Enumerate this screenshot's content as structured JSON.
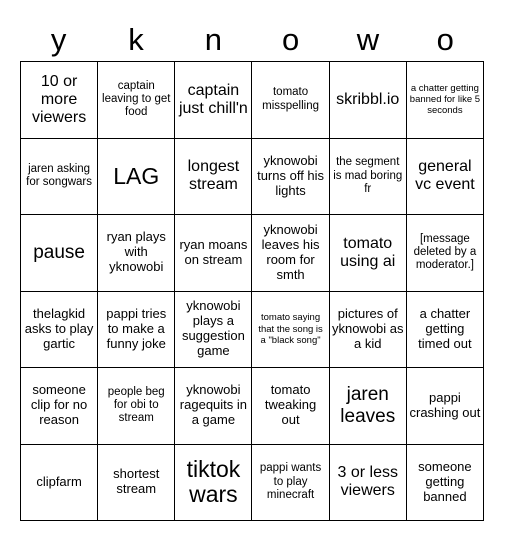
{
  "card": {
    "header_letters": [
      "y",
      "k",
      "n",
      "o",
      "w",
      "o"
    ],
    "rows": [
      [
        {
          "text": "10 or more viewers",
          "size": "lg"
        },
        {
          "text": "captain leaving to get food",
          "size": "sm"
        },
        {
          "text": "captain just chill'n",
          "size": "lg"
        },
        {
          "text": "tomato misspelling",
          "size": "sm"
        },
        {
          "text": "skribbl.io",
          "size": "lg"
        },
        {
          "text": "a chatter getting banned for like 5 seconds",
          "size": "xs"
        }
      ],
      [
        {
          "text": "jaren asking for songwars",
          "size": "sm"
        },
        {
          "text": "LAG",
          "size": "xxl"
        },
        {
          "text": "longest stream",
          "size": "lg"
        },
        {
          "text": "yknowobi turns off his lights",
          "size": "md"
        },
        {
          "text": "the segment is mad boring fr",
          "size": "sm"
        },
        {
          "text": "general vc event",
          "size": "lg"
        }
      ],
      [
        {
          "text": "pause",
          "size": "xl"
        },
        {
          "text": "ryan plays with yknowobi",
          "size": "md"
        },
        {
          "text": "ryan moans on stream",
          "size": "md"
        },
        {
          "text": "yknowobi leaves his room for smth",
          "size": "md"
        },
        {
          "text": "tomato using ai",
          "size": "lg"
        },
        {
          "text": "[message deleted by a moderator.]",
          "size": "sm"
        }
      ],
      [
        {
          "text": "thelagkid asks to play gartic",
          "size": "md"
        },
        {
          "text": "pappi tries to make a funny joke",
          "size": "md"
        },
        {
          "text": "yknowobi plays a suggestion game",
          "size": "md"
        },
        {
          "text": "tomato saying that the song is a \"black song\"",
          "size": "xs"
        },
        {
          "text": "pictures of yknowobi as a kid",
          "size": "md"
        },
        {
          "text": "a chatter getting timed out",
          "size": "md"
        }
      ],
      [
        {
          "text": "someone clip for no reason",
          "size": "md"
        },
        {
          "text": "people beg for obi to stream",
          "size": "sm"
        },
        {
          "text": "yknowobi ragequits in a game",
          "size": "md"
        },
        {
          "text": "tomato tweaking out",
          "size": "md"
        },
        {
          "text": "jaren leaves",
          "size": "xl"
        },
        {
          "text": "pappi crashing out",
          "size": "md"
        }
      ],
      [
        {
          "text": "clipfarm",
          "size": "md"
        },
        {
          "text": "shortest stream",
          "size": "md"
        },
        {
          "text": "tiktok wars",
          "size": "xxl"
        },
        {
          "text": "pappi wants to play minecraft",
          "size": "sm"
        },
        {
          "text": "3 or less viewers",
          "size": "lg"
        },
        {
          "text": "someone getting banned",
          "size": "md"
        }
      ]
    ]
  }
}
